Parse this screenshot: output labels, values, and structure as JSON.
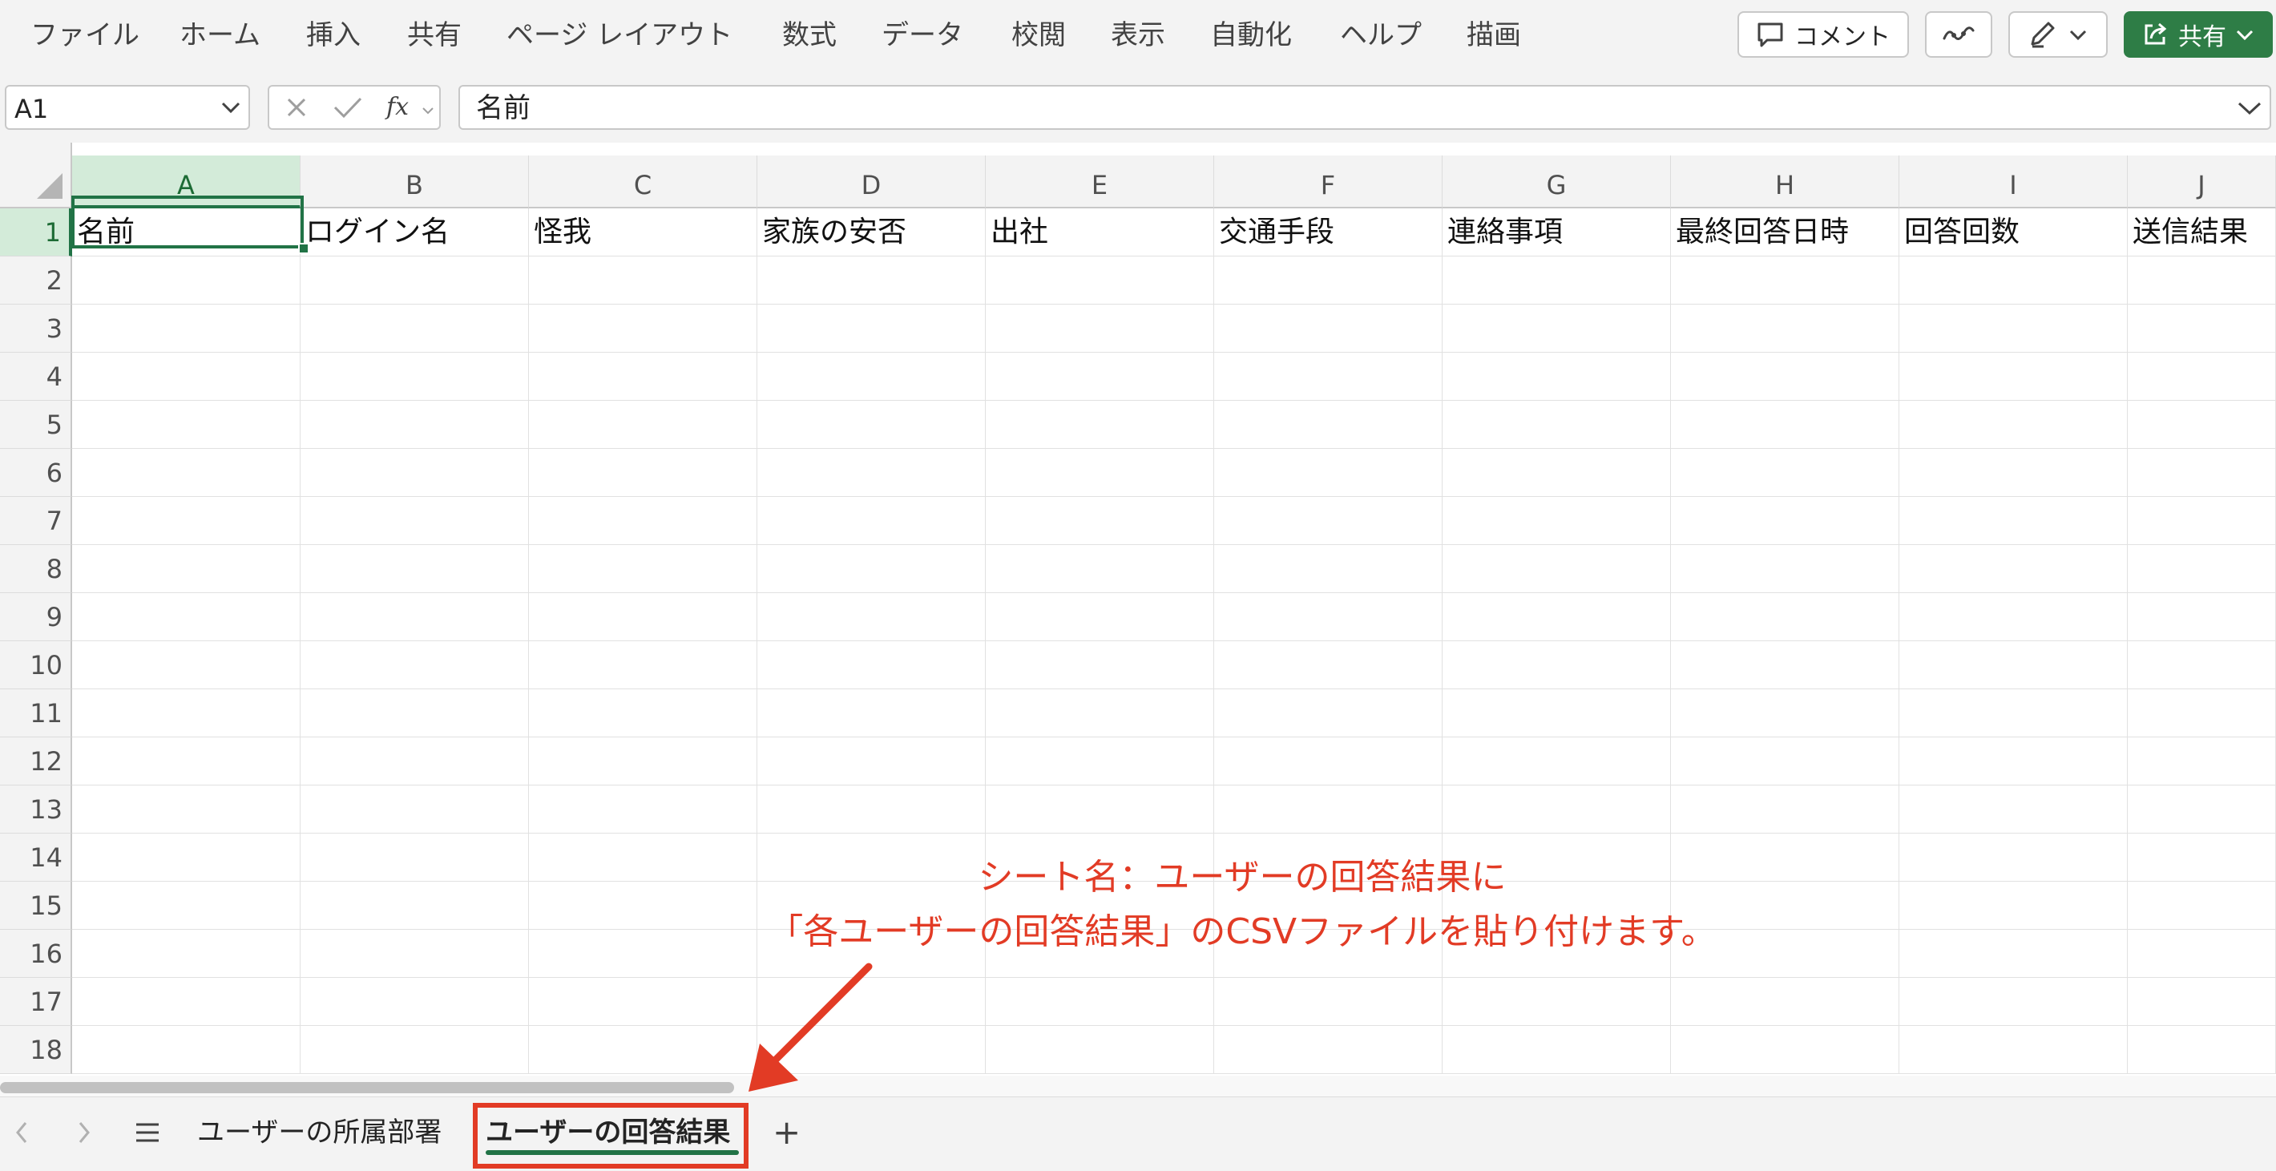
{
  "ribbon": {
    "menu": [
      "ファイル",
      "ホーム",
      "挿入",
      "共有",
      "ページ レイアウト",
      "数式",
      "データ",
      "校閲",
      "表示",
      "自動化",
      "ヘルプ",
      "描画"
    ],
    "comment_label": "コメント",
    "share_label": "共有",
    "accent": "#2e7d46"
  },
  "formula_bar": {
    "name_box": "A1",
    "fx_label": "fx",
    "value": "名前"
  },
  "grid": {
    "columns": [
      "A",
      "B",
      "C",
      "D",
      "E",
      "F",
      "G",
      "H",
      "I",
      "J"
    ],
    "rows": [
      "1",
      "2",
      "3",
      "4",
      "5",
      "6",
      "7",
      "8",
      "9",
      "10",
      "11",
      "12",
      "13",
      "14",
      "15",
      "16",
      "17",
      "18"
    ],
    "row1": [
      "名前",
      "ログイン名",
      "怪我",
      "家族の安否",
      "出社",
      "交通手段",
      "連絡事項",
      "最終回答日時",
      "回答回数",
      "送信結果"
    ],
    "active_cell": "A1",
    "selection_color": "#217346"
  },
  "sheet_tabs": {
    "tabs": [
      "ユーザーの所属部署",
      "ユーザーの回答結果"
    ],
    "active": "ユーザーの回答結果",
    "add_label": "+"
  },
  "annotation": {
    "line1": "シート名：ユーザーの回答結果に",
    "line2": "「各ユーザーの回答結果」のCSVファイルを貼り付けます。",
    "color": "#e23b25"
  }
}
